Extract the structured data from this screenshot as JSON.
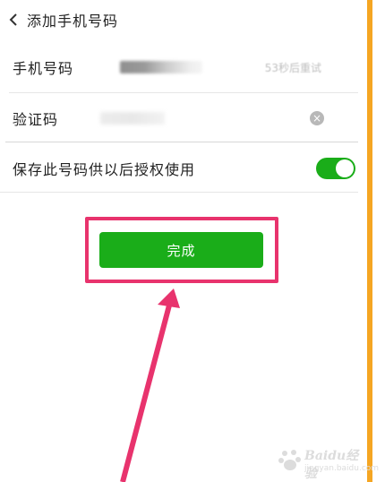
{
  "nav": {
    "title": "添加手机号码",
    "back_icon": "chevron-left-icon"
  },
  "phone_row": {
    "label": "手机号码",
    "countdown_text": "53秒后重试"
  },
  "code_row": {
    "label": "验证码",
    "clear_icon": "clear-circle-icon",
    "clear_glyph": "×"
  },
  "save_row": {
    "label": "保存此号码供以后授权使用",
    "toggle_on": true
  },
  "done_button": {
    "label": "完成"
  },
  "annotation": {
    "highlight_color": "#e8336d",
    "arrow_color": "#e8336d"
  },
  "watermark": {
    "text": "Baidu经验",
    "url": "jingyan.baidu.com"
  },
  "colors": {
    "primary_green": "#1aad19",
    "side_accent": "#f5a623"
  }
}
